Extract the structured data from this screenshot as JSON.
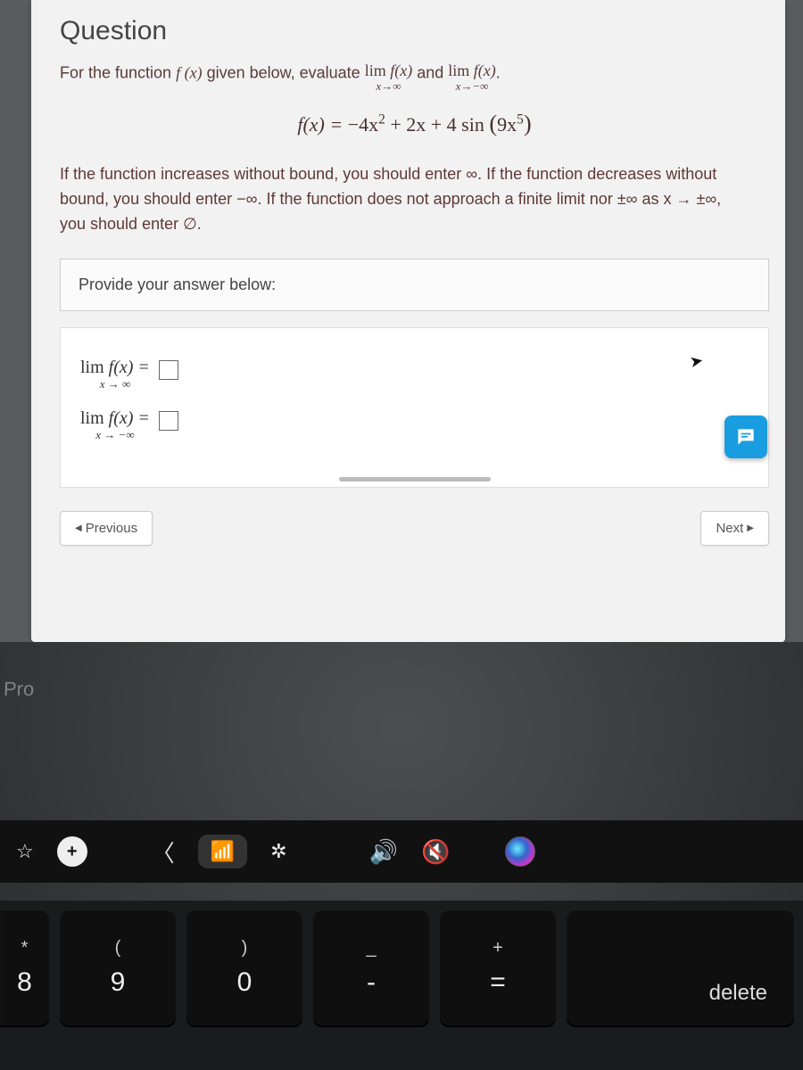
{
  "question": {
    "heading": "Question",
    "prompt_pre": "For the function ",
    "prompt_fx": "f (x)",
    "prompt_mid": " given below, evaluate ",
    "lim1_top": "lim",
    "lim1_fx": "f(x)",
    "lim1_bot": "x→∞",
    "prompt_and": " and ",
    "lim2_top": "lim",
    "lim2_fx": "f(x)",
    "lim2_bot": "x→−∞",
    "prompt_end": ".",
    "formula_lhs": "f(x) = ",
    "formula_rhs_a": "−4x",
    "formula_rhs_exp2": "2",
    "formula_rhs_b": " + 2x + 4 sin ",
    "formula_rhs_paren_open": "(",
    "formula_rhs_c": "9x",
    "formula_rhs_exp5": "5",
    "formula_rhs_paren_close": ")",
    "instructions": "If the function increases without bound, you should enter ∞. If the function decreases without bound, you should enter −∞. If the function does not approach a finite limit nor ±∞ as x → ±∞, you should enter ∅.",
    "provide": "Provide your answer below:",
    "ans1_top": "lim",
    "ans1_fx": "f(x) = ",
    "ans1_bot": "x → ∞",
    "ans2_top": "lim",
    "ans2_fx": "f(x) = ",
    "ans2_bot": "x → −∞"
  },
  "nav": {
    "prev": "Previous",
    "next": "Next"
  },
  "laptop": {
    "pro": "Pro",
    "touchbar": {
      "star": "☆",
      "plus": "+",
      "chev": "〈",
      "signal": "📶",
      "bright": "✲",
      "vol": "🔊",
      "mute": "🔇"
    },
    "keys": {
      "k8_sym": "*",
      "k8_main": "8",
      "k9_sym": "(",
      "k9_main": "9",
      "k0_sym": ")",
      "k0_main": "0",
      "kminus_sym": "_",
      "kminus_main": "-",
      "keq_sym": "+",
      "keq_main": "=",
      "delete": "delete"
    }
  }
}
